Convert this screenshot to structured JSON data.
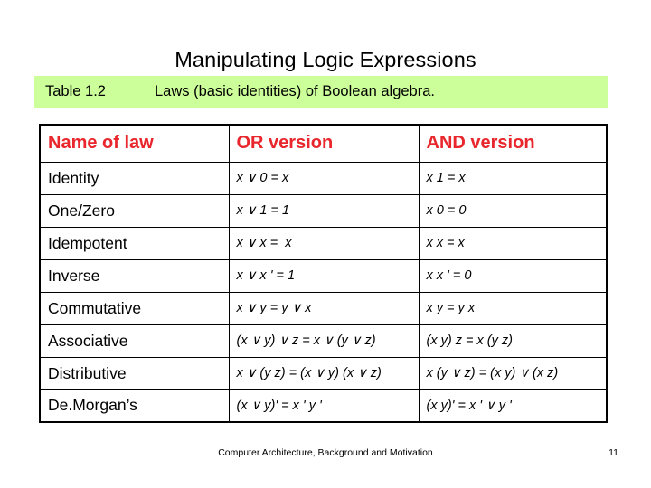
{
  "slide": {
    "title": "Manipulating Logic Expressions",
    "accent_red": "#E8262C",
    "caption_band_green": "#CCFF99"
  },
  "caption": {
    "label": "Table 1.2",
    "text": "Laws (basic identities) of Boolean algebra."
  },
  "table": {
    "headers": {
      "name": "Name of law",
      "or": "OR version",
      "and": "AND version"
    },
    "rows": [
      {
        "name": "Identity",
        "or": "x ∨ 0 = x",
        "and": "x 1 = x"
      },
      {
        "name": "One/Zero",
        "or": "x ∨ 1 = 1",
        "and": "x 0 = 0"
      },
      {
        "name": "Idempotent",
        "or": "x ∨ x =  x",
        "and": "x x = x"
      },
      {
        "name": "Inverse",
        "or": "x ∨ x ' = 1",
        "and": "x x ' = 0"
      },
      {
        "name": "Commutative",
        "or": "x ∨ y = y ∨ x",
        "and": "x y = y x"
      },
      {
        "name": "Associative",
        "or": "(x ∨ y) ∨ z = x ∨ (y ∨ z)",
        "and": "(x y) z = x (y z)"
      },
      {
        "name": "Distributive",
        "or": "x ∨ (y z) = (x ∨ y) (x ∨ z)",
        "and": "x (y ∨ z) = (x y) ∨ (x z)"
      },
      {
        "name": "De.Morgan’s",
        "or": "(x ∨ y)' = x ' y '",
        "and": "(x y)' = x ' ∨ y '"
      }
    ]
  },
  "footer": {
    "text": "Computer Architecture, Background and Motivation",
    "page": "11"
  }
}
